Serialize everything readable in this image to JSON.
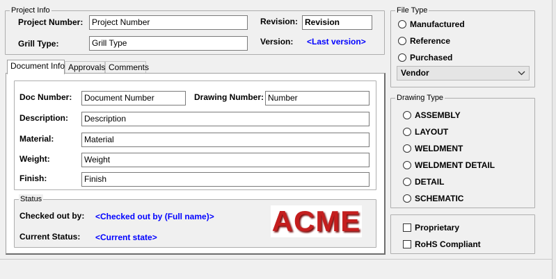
{
  "project_info": {
    "title": "Project Info",
    "project_number_label": "Project Number:",
    "project_number_value": "Project Number",
    "grill_type_label": "Grill Type:",
    "grill_type_value": "Grill Type",
    "revision_label": "Revision:",
    "revision_value": "Revision",
    "version_label": "Version:",
    "version_value": "<Last version>"
  },
  "tabs": [
    {
      "label": "Document Info",
      "active": true
    },
    {
      "label": "Approvals",
      "active": false
    },
    {
      "label": "Comments",
      "active": false
    }
  ],
  "document_info": {
    "doc_number_label": "Doc Number:",
    "doc_number_value": "Document Number",
    "drawing_number_label": "Drawing Number:",
    "drawing_number_value": "Number",
    "description_label": "Description:",
    "description_value": "Description",
    "material_label": "Material:",
    "material_value": "Material",
    "weight_label": "Weight:",
    "weight_value": "Weight",
    "finish_label": "Finish:",
    "finish_value": "Finish"
  },
  "status": {
    "title": "Status",
    "checked_out_label": "Checked out by:",
    "checked_out_value": "<Checked out by (Full name)>",
    "current_status_label": "Current Status:",
    "current_status_value": "<Current state>"
  },
  "logo": {
    "text": "ACME",
    "color": "#c41e1e"
  },
  "file_type": {
    "title": "File Type",
    "options": [
      "Manufactured",
      "Reference",
      "Purchased"
    ],
    "vendor_select": "Vendor"
  },
  "drawing_type": {
    "title": "Drawing Type",
    "options": [
      "ASSEMBLY",
      "LAYOUT",
      "WELDMENT",
      "WELDMENT DETAIL",
      "DETAIL",
      "SCHEMATIC"
    ]
  },
  "flags": {
    "proprietary_label": "Proprietary",
    "rohs_label": "RoHS Compliant"
  },
  "colors": {
    "link_blue": "#0000ff",
    "background": "#f0f0f0"
  }
}
